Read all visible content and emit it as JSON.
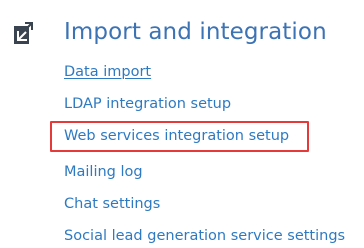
{
  "section": {
    "icon": "pencil-square-icon",
    "title": "Import and integration"
  },
  "links": [
    {
      "label": "Data import",
      "underlined": true
    },
    {
      "label": "LDAP integration setup",
      "underlined": false
    },
    {
      "label": "Web services integration setup",
      "underlined": false,
      "highlighted": true
    },
    {
      "label": "Mailing log",
      "underlined": false
    },
    {
      "label": "Chat settings",
      "underlined": false
    },
    {
      "label": "Social lead generation service settings",
      "underlined": false
    }
  ],
  "colors": {
    "accent": "#3c73b4",
    "link": "#2e7ac2",
    "highlight": "#e53a3a",
    "icon": "#3a4350"
  }
}
